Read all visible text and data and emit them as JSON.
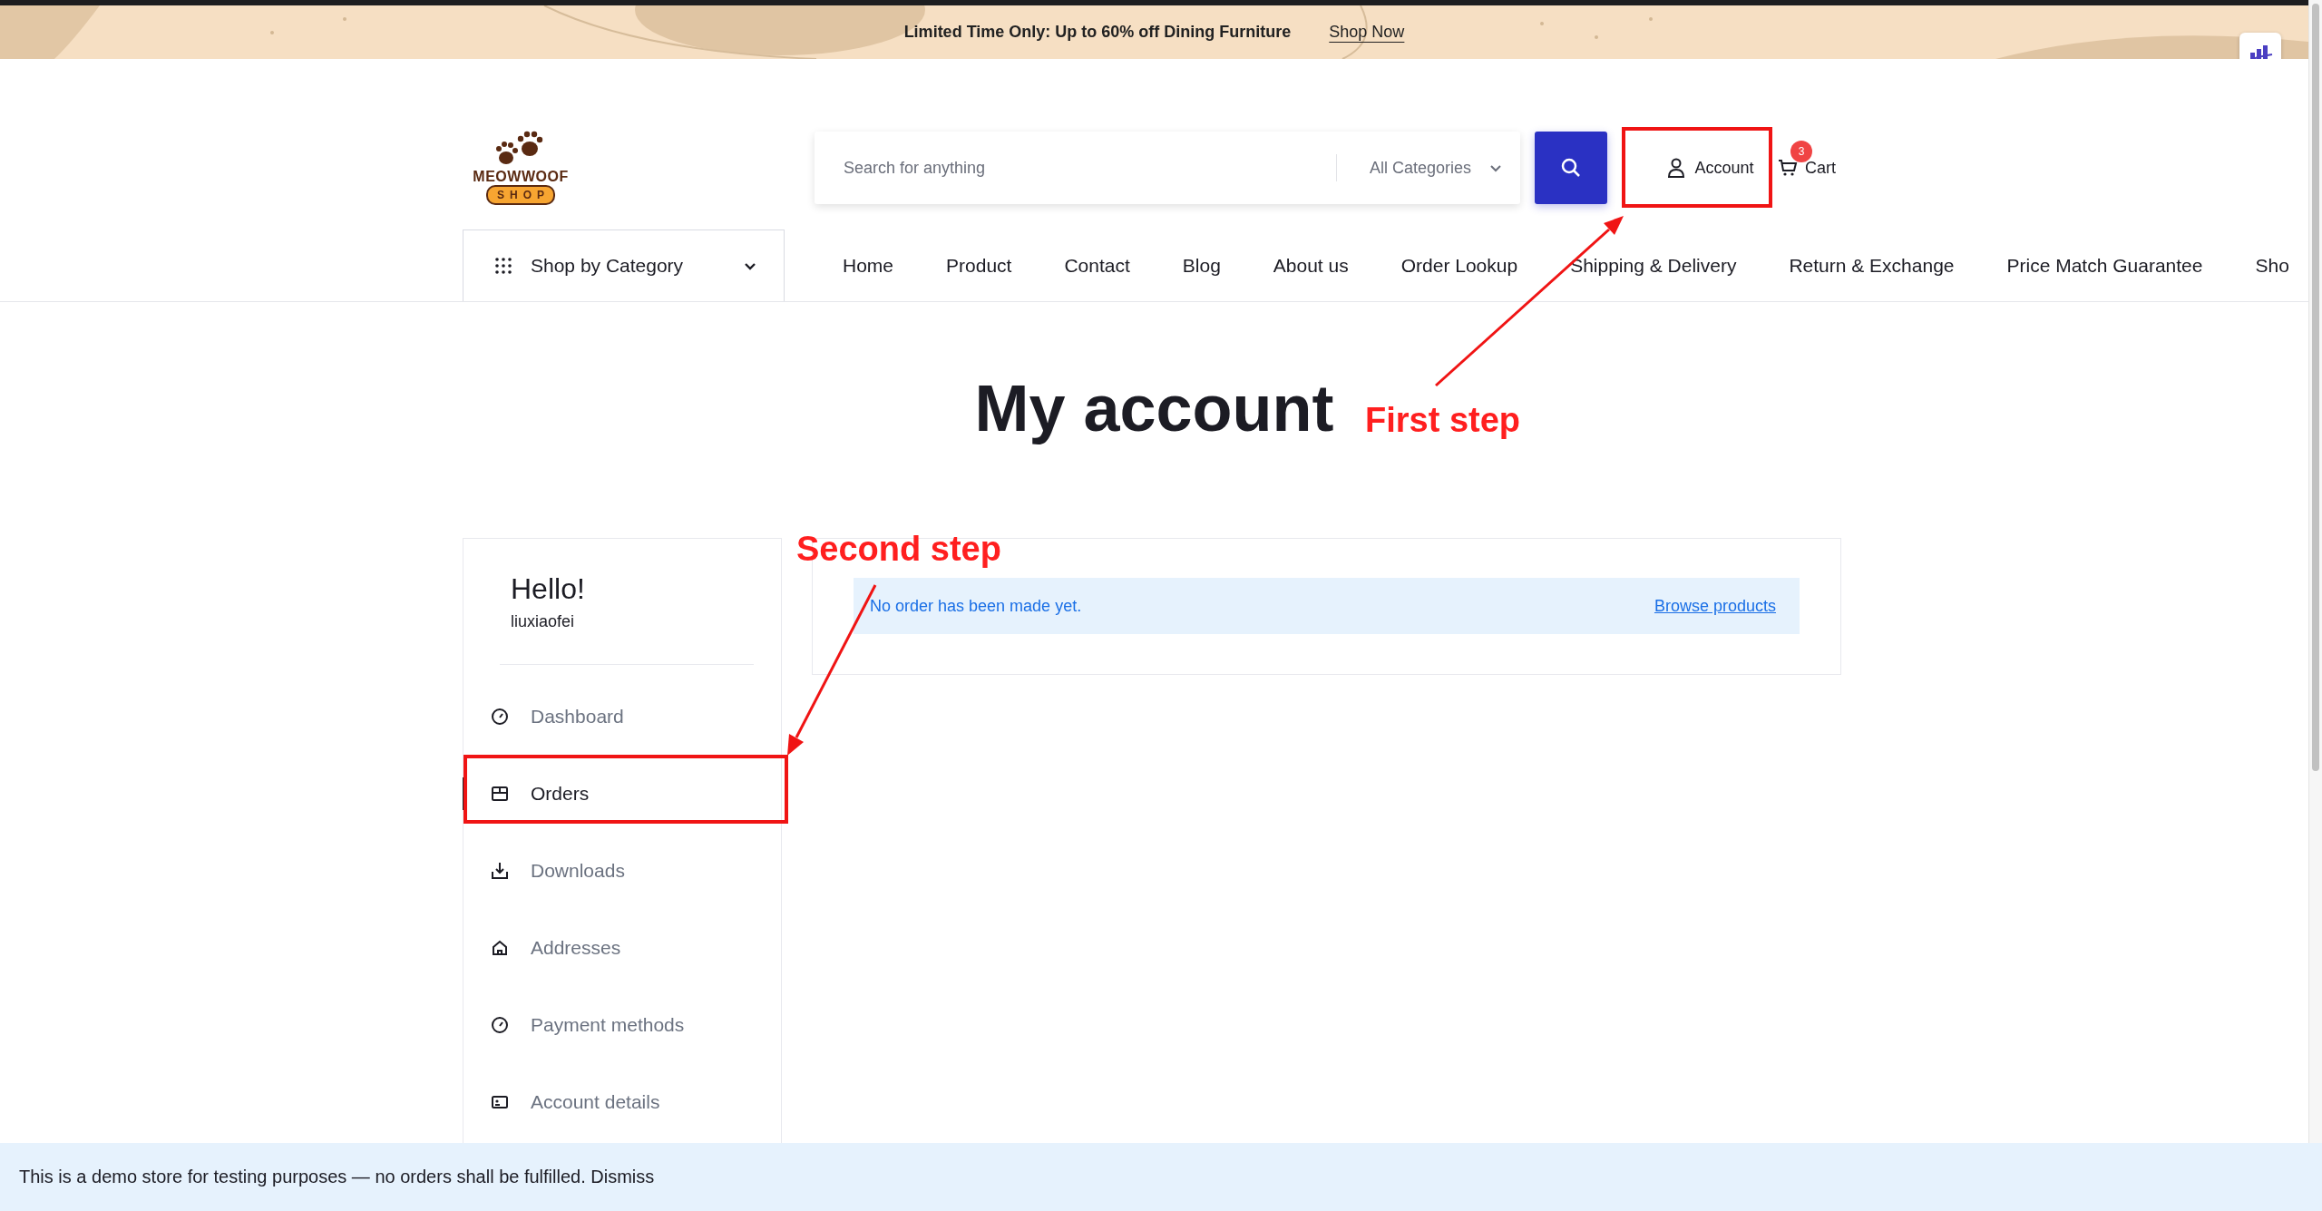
{
  "banner": {
    "text": "Limited Time Only: Up to 60% off Dining Furniture",
    "link": "Shop Now"
  },
  "header": {
    "logo": {
      "name": "MEOWWOOF",
      "tag": "SHOP"
    },
    "search": {
      "placeholder": "Search for anything",
      "category": "All Categories"
    },
    "account": "Account",
    "cart": {
      "label": "Cart",
      "count": "3"
    }
  },
  "category_menu": {
    "label": "Shop by Category"
  },
  "nav": [
    {
      "label": "Home"
    },
    {
      "label": "Product"
    },
    {
      "label": "Contact"
    },
    {
      "label": "Blog"
    },
    {
      "label": "About us"
    },
    {
      "label": "Order Lookup"
    },
    {
      "label": "Shipping & Delivery"
    },
    {
      "label": "Return & Exchange"
    },
    {
      "label": "Price Match Guarantee"
    },
    {
      "label": "Sho"
    }
  ],
  "page_title": "My account",
  "sidebar": {
    "greeting": "Hello!",
    "username": "liuxiaofei",
    "items": [
      {
        "label": "Dashboard",
        "selected": false
      },
      {
        "label": "Orders",
        "selected": true
      },
      {
        "label": "Downloads",
        "selected": false
      },
      {
        "label": "Addresses",
        "selected": false
      },
      {
        "label": "Payment methods",
        "selected": false
      },
      {
        "label": "Account details",
        "selected": false
      }
    ]
  },
  "notice": {
    "text": "No order has been made yet.",
    "link": "Browse products"
  },
  "annotations": [
    {
      "text": "First step"
    },
    {
      "text": "Second step"
    }
  ],
  "store_notice": {
    "text": "This is a demo store for testing purposes — no orders shall be fulfilled.",
    "link": "Dismiss"
  }
}
